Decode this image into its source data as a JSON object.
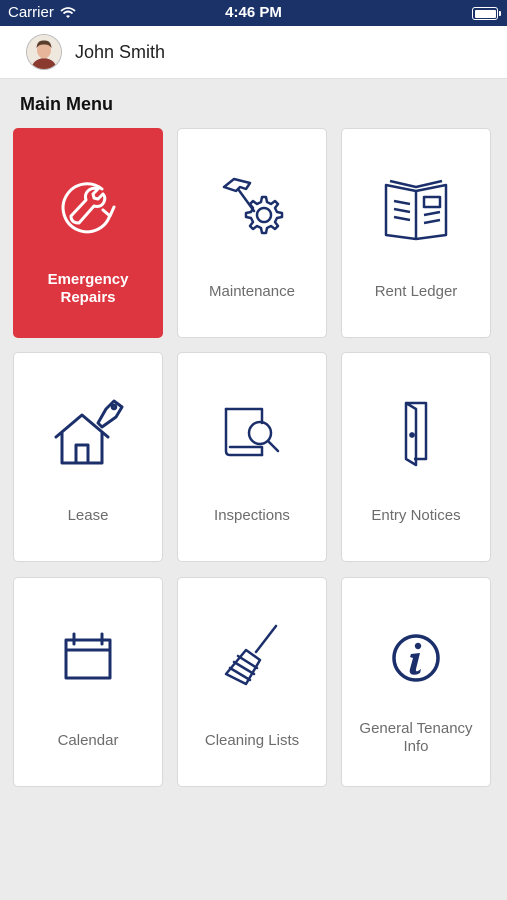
{
  "status_bar": {
    "carrier": "Carrier",
    "time": "4:46 PM"
  },
  "user": {
    "name": "John Smith"
  },
  "main_menu": {
    "title": "Main Menu",
    "tiles": [
      {
        "label": "Emergency Repairs",
        "icon": "wrench-refresh-icon"
      },
      {
        "label": "Maintenance",
        "icon": "hammer-gear-icon"
      },
      {
        "label": "Rent Ledger",
        "icon": "open-book-icon"
      },
      {
        "label": "Lease",
        "icon": "house-tag-icon"
      },
      {
        "label": "Inspections",
        "icon": "book-magnifier-icon"
      },
      {
        "label": "Entry Notices",
        "icon": "open-door-icon"
      },
      {
        "label": "Calendar",
        "icon": "calendar-icon"
      },
      {
        "label": "Cleaning Lists",
        "icon": "broom-icon"
      },
      {
        "label": "General Tenancy Info",
        "icon": "info-icon"
      }
    ]
  },
  "colors": {
    "status_bar": "#1a3268",
    "accent": "#de3640",
    "icon": "#1b2f6b"
  }
}
